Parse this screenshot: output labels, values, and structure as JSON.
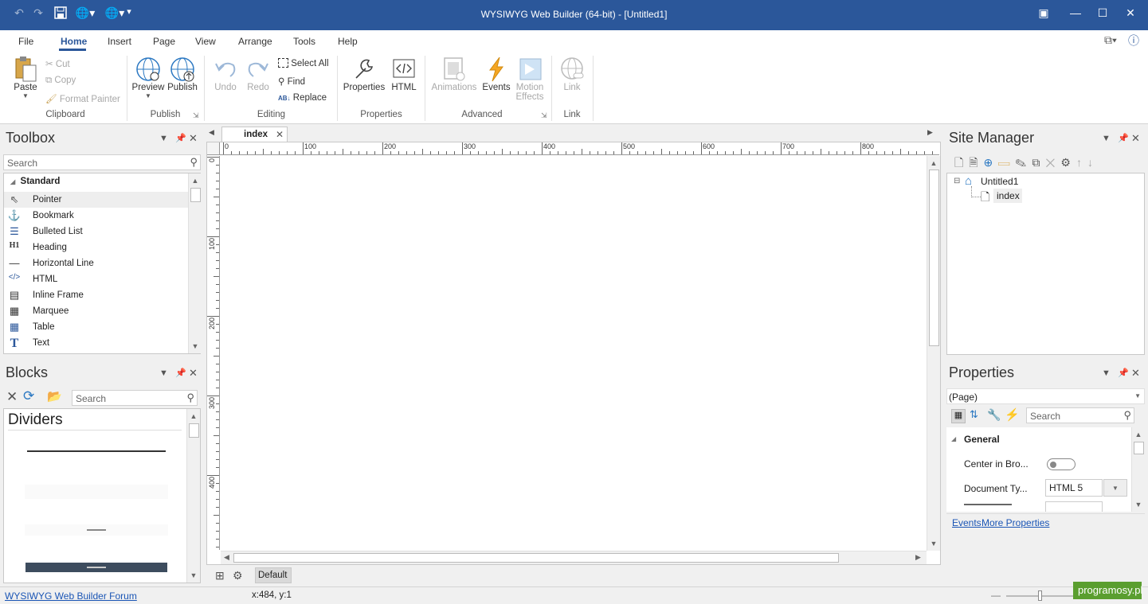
{
  "app": {
    "title": "WYSIWYG Web Builder (64-bit) - [Untitled1]"
  },
  "menu": {
    "tabs": [
      "File",
      "Home",
      "Insert",
      "Page",
      "View",
      "Arrange",
      "Tools",
      "Help"
    ],
    "active": "Home"
  },
  "ribbon": {
    "clipboard": {
      "label": "Clipboard",
      "paste": "Paste",
      "cut": "Cut",
      "copy": "Copy",
      "format_painter": "Format Painter"
    },
    "publish": {
      "label": "Publish",
      "preview": "Preview",
      "publish": "Publish"
    },
    "editing": {
      "label": "Editing",
      "undo": "Undo",
      "redo": "Redo",
      "select_all": "Select All",
      "find": "Find",
      "replace": "Replace"
    },
    "properties": {
      "label": "Properties",
      "properties": "Properties",
      "html": "HTML"
    },
    "advanced": {
      "label": "Advanced",
      "animations": "Animations",
      "events": "Events",
      "motion_1": "Motion",
      "motion_2": "Effects"
    },
    "link": {
      "label": "Link",
      "link": "Link"
    }
  },
  "toolbox": {
    "title": "Toolbox",
    "search_placeholder": "Search",
    "group": "Standard",
    "items": [
      {
        "label": "Pointer",
        "icon": "pointer-icon"
      },
      {
        "label": "Bookmark",
        "icon": "anchor-icon"
      },
      {
        "label": "Bulleted List",
        "icon": "list-icon"
      },
      {
        "label": "Heading",
        "icon": "heading-icon"
      },
      {
        "label": "Horizontal Line",
        "icon": "hline-icon"
      },
      {
        "label": "HTML",
        "icon": "code-icon"
      },
      {
        "label": "Inline Frame",
        "icon": "iframe-icon"
      },
      {
        "label": "Marquee",
        "icon": "marquee-icon"
      },
      {
        "label": "Table",
        "icon": "table-icon"
      },
      {
        "label": "Text",
        "icon": "text-icon"
      }
    ]
  },
  "blocks": {
    "title": "Blocks",
    "search_placeholder": "Search",
    "category": "Dividers"
  },
  "editor": {
    "tab": "index",
    "ruler_h": [
      "0",
      "100",
      "200",
      "300",
      "400",
      "500",
      "600",
      "700",
      "800"
    ],
    "ruler_v": [
      "0",
      "100",
      "200",
      "300",
      "400",
      "500"
    ],
    "layer": "Default"
  },
  "site_manager": {
    "title": "Site Manager",
    "root": "Untitled1",
    "page": "index"
  },
  "properties": {
    "title": "Properties",
    "object": "(Page)",
    "search_placeholder": "Search",
    "group": "General",
    "rows": [
      {
        "name": "Center in Bro...",
        "value": ""
      },
      {
        "name": "Document Ty...",
        "value": "HTML 5"
      }
    ],
    "links": [
      "Events",
      "More Properties"
    ]
  },
  "status": {
    "forum_link": "WYSIWYG Web Builder Forum",
    "coords": "x:484, y:1",
    "watermark": "programosy.pl"
  },
  "colors": {
    "accent": "#2b579a",
    "link": "#1a55b5",
    "watermark": "#5a9e2f"
  }
}
